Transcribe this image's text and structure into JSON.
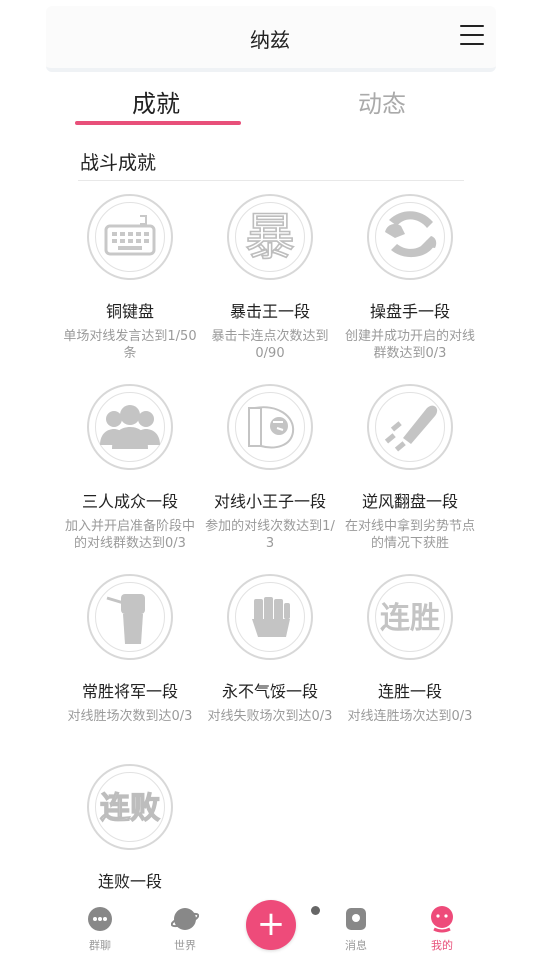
{
  "header": {
    "title": "纳兹"
  },
  "tabs": [
    {
      "label": "成就",
      "active": true
    },
    {
      "label": "动态",
      "active": false
    }
  ],
  "section": {
    "title": "战斗成就"
  },
  "achievements": [
    {
      "icon": "keyboard-icon",
      "name": "铜键盘",
      "desc": "单场对线发言达到1/50条"
    },
    {
      "icon": "bao-character-icon",
      "name": "暴击王一段",
      "desc": "暴击卡连点次数达到0/90"
    },
    {
      "icon": "hands-icon",
      "name": "操盘手一段",
      "desc": "创建并成功开启的对线群数达到0/3"
    },
    {
      "icon": "group-icon",
      "name": "三人成众一段",
      "desc": "加入并开启准备阶段中的对线群数达到0/3"
    },
    {
      "icon": "prince-icon",
      "name": "对线小王子一段",
      "desc": "参加的对线次数达到1/ 3"
    },
    {
      "icon": "comet-icon",
      "name": "逆风翻盘一段",
      "desc": "在对线中拿到劣势节点的情况下获胜"
    },
    {
      "icon": "raised-fist-icon",
      "name": "常胜将军一段",
      "desc": "对线胜场次数到达0/3"
    },
    {
      "icon": "fist-icon",
      "name": "永不气馁一段",
      "desc": "对线失败场次到达0/3"
    },
    {
      "icon": "win-streak-icon",
      "name": "连胜一段",
      "desc": "对线连胜场次达到0/3",
      "glyph": "连胜"
    },
    {
      "icon": "lose-streak-icon",
      "name": "连败一段",
      "desc": "",
      "glyph": "连败"
    }
  ],
  "badge_glyphs": {
    "bao": "暴"
  },
  "nav": [
    {
      "label": "群聊",
      "icon": "chat-icon"
    },
    {
      "label": "世界",
      "icon": "planet-icon"
    },
    {
      "label": "",
      "icon": "plus-icon"
    },
    {
      "label": "消息",
      "icon": "message-icon"
    },
    {
      "label": "我的",
      "icon": "profile-icon",
      "active": true
    }
  ],
  "colors": {
    "accent": "#e8507a",
    "icon_gray": "#c8c8c8",
    "text_gray": "#9a9a9a"
  }
}
